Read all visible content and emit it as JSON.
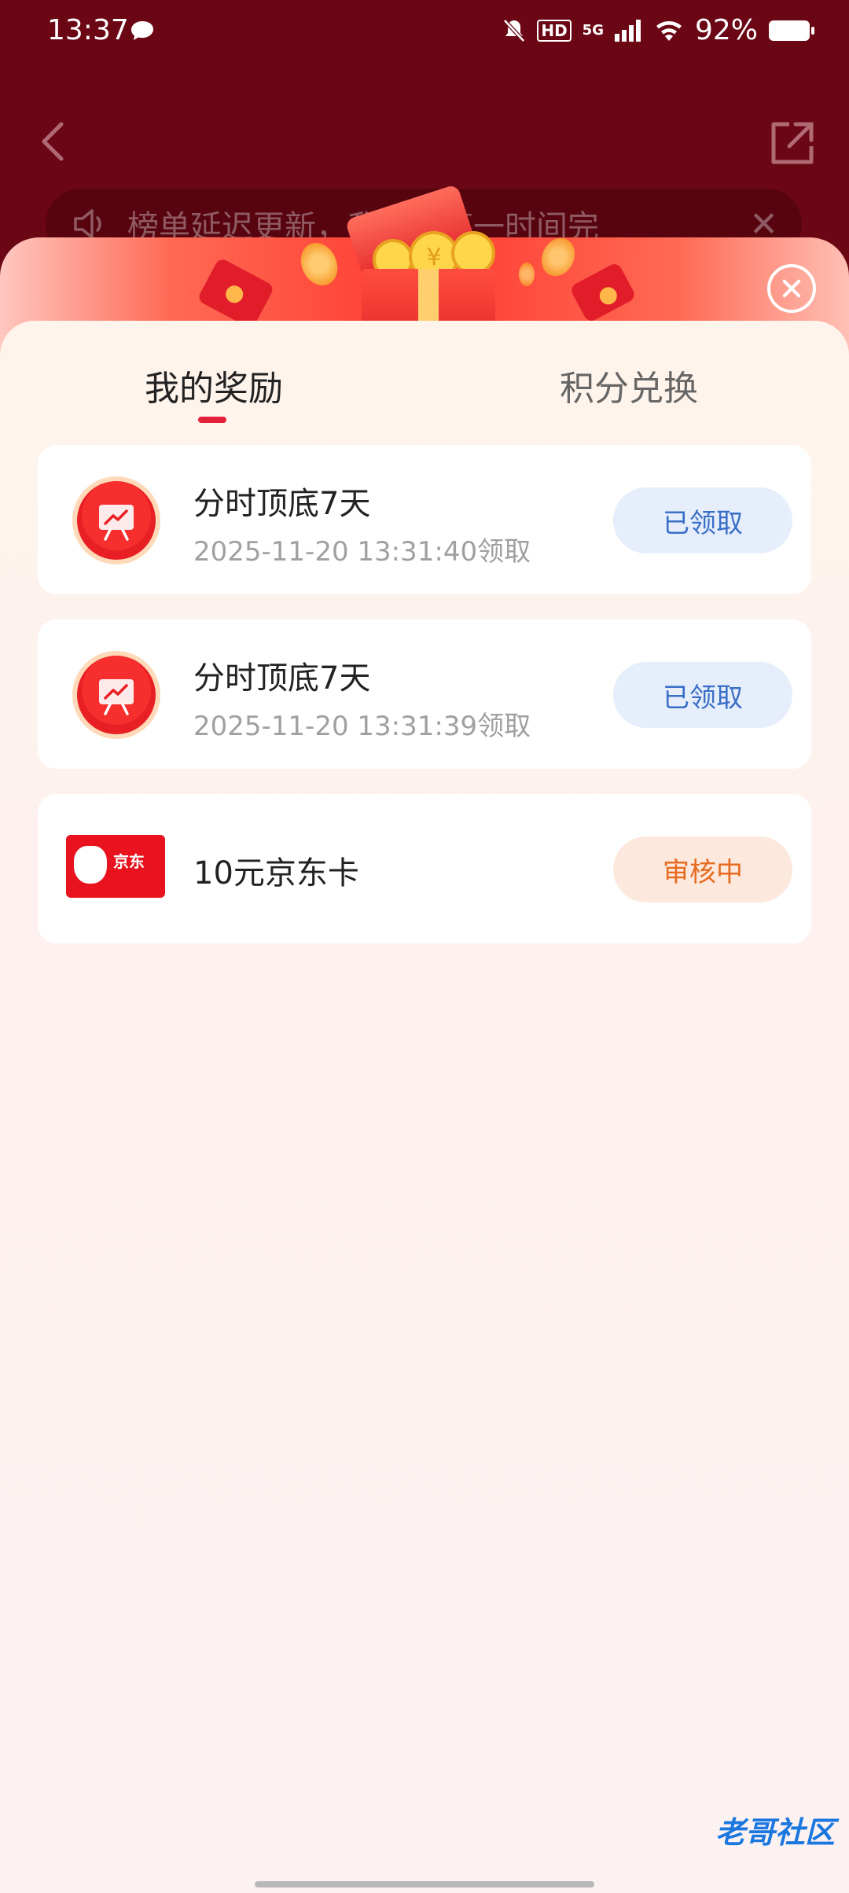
{
  "status_bar": {
    "time": "13:37",
    "hd": "HD",
    "network": "5G",
    "battery": "92%"
  },
  "notice": {
    "text": "榜单延迟更新，我们将第一时间完"
  },
  "tabs": [
    {
      "label": "我的奖励",
      "active": true
    },
    {
      "label": "积分兑换",
      "active": false
    }
  ],
  "rewards": [
    {
      "title": "分时顶底7天",
      "time": "2025-11-20 13:31:40领取",
      "status": "已领取",
      "icon": "chart-presentation-icon"
    },
    {
      "title": "分时顶底7天",
      "time": "2025-11-20 13:31:39领取",
      "status": "已领取",
      "icon": "chart-presentation-icon"
    },
    {
      "title": "10元京东卡",
      "status": "审核中",
      "icon": "jd-card-icon",
      "brand": "京东"
    }
  ],
  "watermark": "老哥社区",
  "colors": {
    "accent": "#e3213a",
    "received": "#3a6fc7",
    "reviewing": "#e66a1f",
    "backdrop": "#6b0715"
  }
}
